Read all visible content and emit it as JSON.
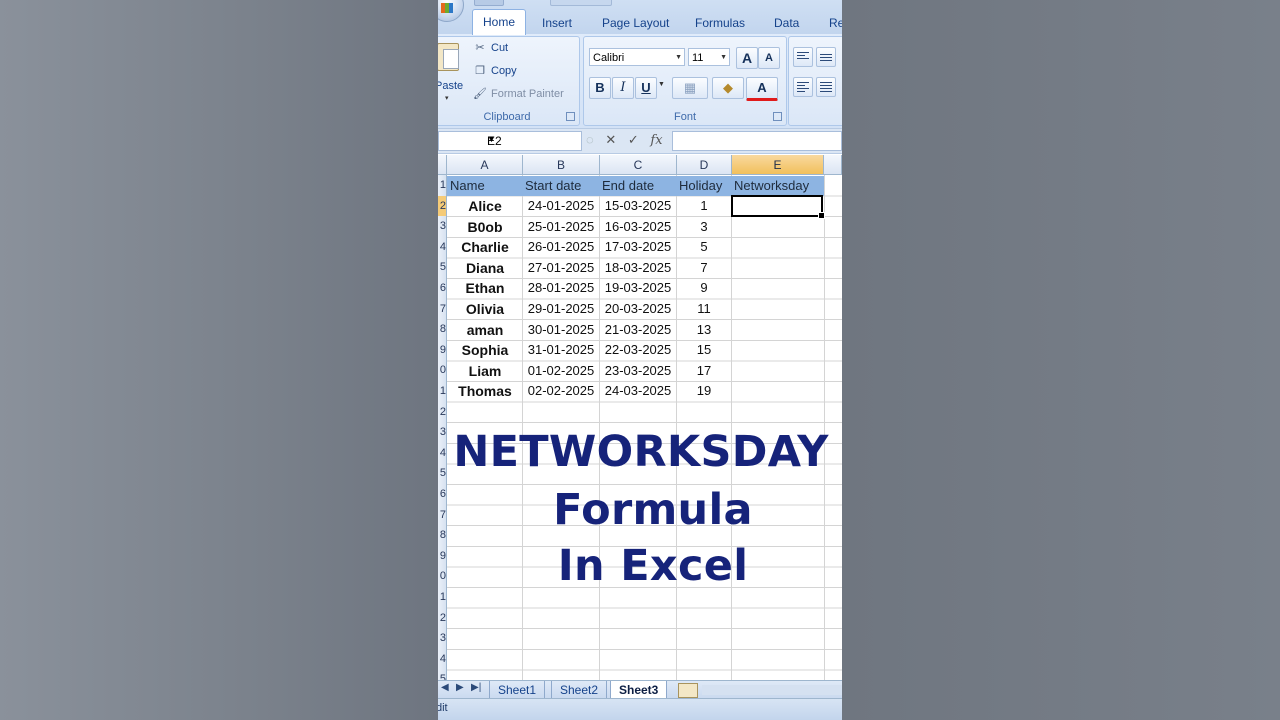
{
  "ribbon": {
    "tabs": [
      "Home",
      "Insert",
      "Page Layout",
      "Formulas",
      "Data",
      "Re"
    ],
    "clipboard": {
      "paste": "Paste",
      "cut": "Cut",
      "copy": "Copy",
      "format_painter": "Format Painter",
      "group_label": "Clipboard"
    },
    "font": {
      "family": "Calibri",
      "size": "11",
      "grow": "A",
      "shrink": "A",
      "bold": "B",
      "italic": "I",
      "underline": "U",
      "color_letter": "A",
      "group_label": "Font"
    }
  },
  "formula_bar": {
    "name_box": "E2",
    "cancel": "✕",
    "enter": "✓",
    "fx": "fx",
    "value": ""
  },
  "sheet": {
    "columns": [
      "A",
      "B",
      "C",
      "D",
      "E"
    ],
    "row_numbers": [
      "1",
      "2",
      "3",
      "4",
      "5",
      "6",
      "7",
      "8",
      "9",
      "0",
      "1",
      "2",
      "3",
      "4",
      "5",
      "6",
      "7",
      "8",
      "9",
      "0",
      "1",
      "2",
      "3",
      "4",
      "5"
    ],
    "headers": [
      "Name",
      "Start date",
      "End date",
      "Holiday",
      "Networksday"
    ],
    "rows": [
      [
        "Alice",
        "24-01-2025",
        "15-03-2025",
        "1"
      ],
      [
        "B0ob",
        "25-01-2025",
        "16-03-2025",
        "3"
      ],
      [
        "Charlie",
        "26-01-2025",
        "17-03-2025",
        "5"
      ],
      [
        "Diana",
        "27-01-2025",
        "18-03-2025",
        "7"
      ],
      [
        "Ethan",
        "28-01-2025",
        "19-03-2025",
        "9"
      ],
      [
        "Olivia",
        "29-01-2025",
        "20-03-2025",
        "11"
      ],
      [
        "aman",
        "30-01-2025",
        "21-03-2025",
        "13"
      ],
      [
        "Sophia",
        "31-01-2025",
        "22-03-2025",
        "15"
      ],
      [
        "Liam",
        "01-02-2025",
        "23-03-2025",
        "17"
      ],
      [
        "Thomas",
        "02-02-2025",
        "24-03-2025",
        "19"
      ]
    ],
    "selected_cell": "E2"
  },
  "overlay": {
    "line1": "NETWORKSDAY",
    "line2": "Formula",
    "line3": "In Excel"
  },
  "sheet_tabs": [
    "Sheet1",
    "Sheet2",
    "Sheet3"
  ],
  "active_sheet": "Sheet3",
  "status": "dit",
  "colors": {
    "header_fill": "#8db4e2",
    "overlay_text": "#16237a",
    "ribbon_text": "#15428b",
    "selected_header": "#f1c05c"
  }
}
